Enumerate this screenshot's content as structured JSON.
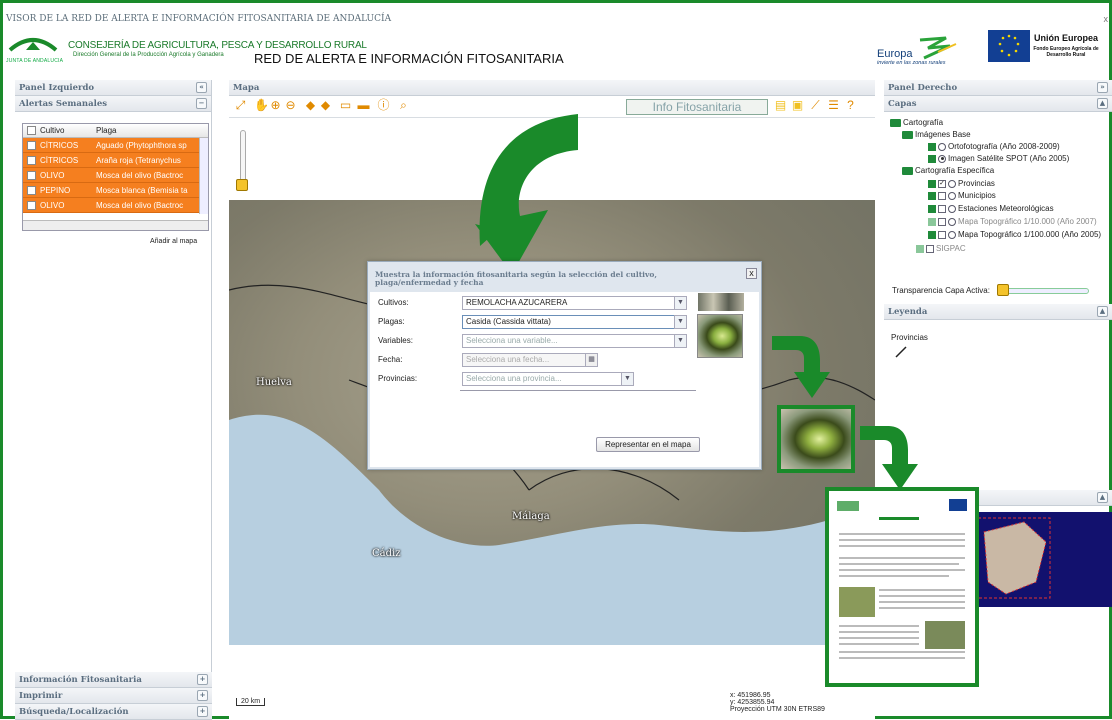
{
  "header": {
    "title": "VISOR DE LA RED DE ALERTA E INFORMACIÓN FITOSANITARIA DE ANDALUCÍA",
    "close": "x",
    "junta_label": "JUNTA DE ANDALUCIA",
    "consejeria": "CONSEJERÍA DE AGRICULTURA, PESCA Y DESARROLLO RURAL",
    "direccion": "Dirección General de la Producción Agrícola y Ganadera",
    "red_title": "RED DE ALERTA E INFORMACIÓN FITOSANITARIA",
    "europa": "Europa",
    "europa_sub": "invierte en las zonas rurales",
    "ue": "Unión Europea",
    "ue_sub": "Fondo Europeo Agrícola de Desarrollo Rural"
  },
  "left_panel": {
    "title": "Panel Izquierdo",
    "collapse": "«",
    "alertas": "Alertas Semanales",
    "alertas_btn": "−",
    "columns": [
      "Cultivo",
      "Plaga"
    ],
    "rows": [
      {
        "cultivo": "CÍTRICOS",
        "plaga": "Aguado (Phytophthora sp"
      },
      {
        "cultivo": "CÍTRICOS",
        "plaga": "Araña roja (Tetranychus"
      },
      {
        "cultivo": "OLIVO",
        "plaga": "Mosca del olivo (Bactroc"
      },
      {
        "cultivo": "PEPINO",
        "plaga": "Mosca blanca (Bemisia ta"
      },
      {
        "cultivo": "OLIVO",
        "plaga": "Mosca del olivo (Bactroc"
      }
    ],
    "add_to_map": "Añadir al mapa",
    "sections": [
      {
        "label": "Información Fitosanitaria",
        "btn": "+"
      },
      {
        "label": "Imprimir",
        "btn": "+"
      },
      {
        "label": "Búsqueda/Localización",
        "btn": "+"
      }
    ]
  },
  "map": {
    "title": "Mapa",
    "info_button": "Info Fitosanitaria",
    "cities": [
      "Huelva",
      "Málaga",
      "Cádiz"
    ],
    "scale": "20 km",
    "coords": [
      "x: 451986.95",
      "y: 4253855.94",
      "Proyección UTM 30N ETRS89"
    ]
  },
  "dialog": {
    "title": "Muestra la información fitosanitaria según la selección del cultivo, plaga/enfermedad y fecha",
    "close": "x",
    "fields": [
      {
        "label": "Cultivos:",
        "value": "REMOLACHA AZUCARERA",
        "placeholder": false
      },
      {
        "label": "Plagas:",
        "value": "Casida (Cassida vittata)",
        "placeholder": false
      },
      {
        "label": "Variables:",
        "value": "Selecciona una variable...",
        "placeholder": true
      },
      {
        "label": "Fecha:",
        "value": "Selecciona una fecha...",
        "placeholder": true
      },
      {
        "label": "Provincias:",
        "value": "Selecciona una provincia...",
        "placeholder": true
      }
    ],
    "submit": "Representar en el mapa"
  },
  "right_panel": {
    "title": "Panel Derecho",
    "collapse": "»",
    "capas": "Capas",
    "capas_btn": "▲",
    "tree": {
      "cartografia": "Cartografía",
      "imagenes_base": "Imágenes Base",
      "ortofoto": "Ortofotografía (Año 2008-2009)",
      "spot": "Imagen Satélite SPOT (Año 2005)",
      "especifica": "Cartografía Específica",
      "provincias": "Provincias",
      "municipios": "Municipios",
      "estaciones": "Estaciones Meteorológicas",
      "topo10": "Mapa Topográfico 1/10.000 (Año 2007)",
      "topo100": "Mapa Topográfico 1/100.000 (Año 2005)",
      "sigpac": "SIGPAC"
    },
    "transparencia": "Transparencia Capa Activa:",
    "leyenda": "Leyenda",
    "leyenda_btn": "▲",
    "leyenda_item": "Provincias",
    "overview_btn": "▲"
  },
  "colors": {
    "accent": "#1a8a2a",
    "alert_row": "#f57f1f",
    "panel_text": "#5b6e80"
  }
}
